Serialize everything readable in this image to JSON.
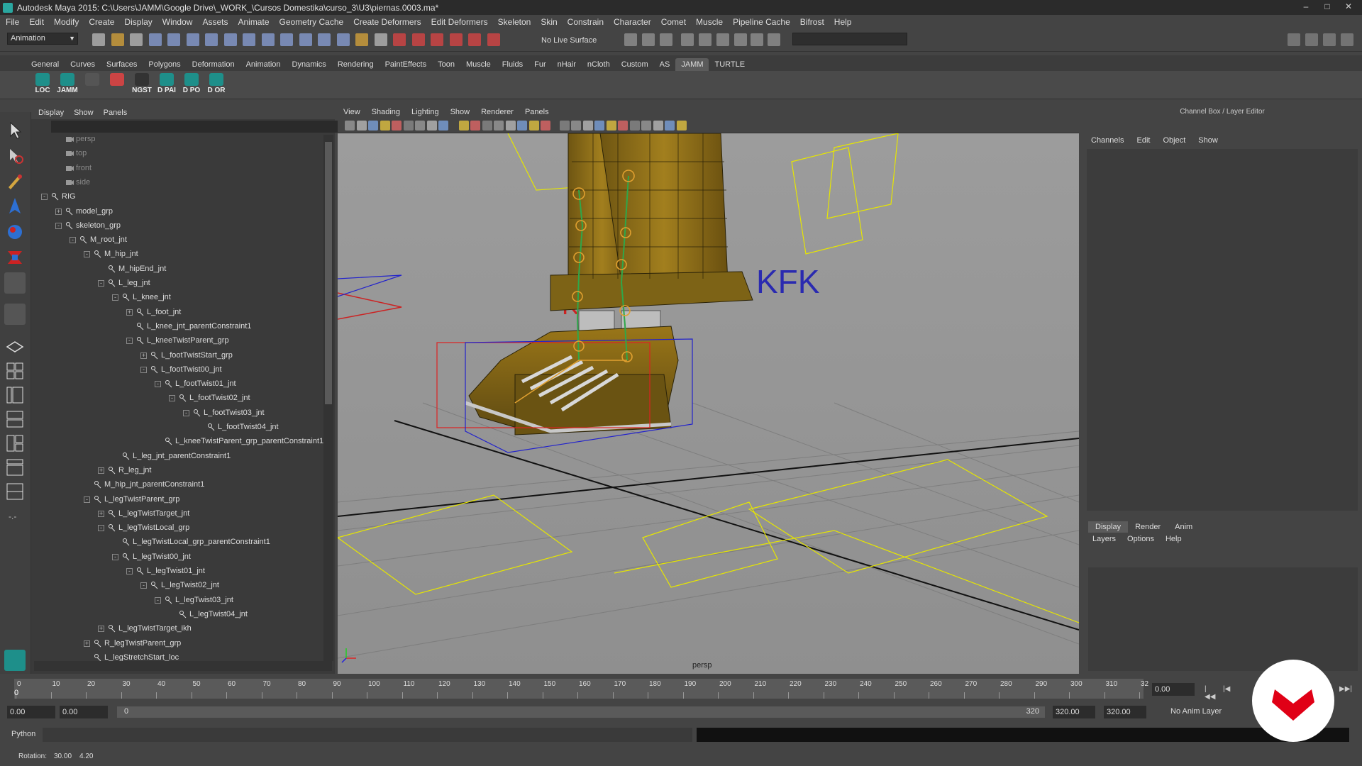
{
  "window": {
    "title": "Autodesk Maya 2015: C:\\Users\\JAMM\\Google Drive\\_WORK_\\Cursos Domestika\\curso_3\\U3\\piernas.0003.ma*"
  },
  "menubar": [
    "File",
    "Edit",
    "Modify",
    "Create",
    "Display",
    "Window",
    "Assets",
    "Animate",
    "Geometry Cache",
    "Create Deformers",
    "Edit Deformers",
    "Skeleton",
    "Skin",
    "Constrain",
    "Character",
    "Comet",
    "Muscle",
    "Pipeline Cache",
    "Bifrost",
    "Help"
  ],
  "statusline": {
    "mode": "Animation",
    "live_surface": "No Live Surface"
  },
  "shelf": {
    "tabs": [
      "General",
      "Curves",
      "Surfaces",
      "Polygons",
      "Deformation",
      "Animation",
      "Dynamics",
      "Rendering",
      "PaintEffects",
      "Toon",
      "Muscle",
      "Fluids",
      "Fur",
      "nHair",
      "nCloth",
      "Custom",
      "AS",
      "JAMM",
      "TURTLE"
    ],
    "active_tab": "JAMM",
    "buttons": [
      "LOC",
      "JAMM",
      "",
      "",
      "NGST",
      "D PAI",
      "D PO",
      "D OR"
    ]
  },
  "outliner": {
    "menu": [
      "Display",
      "Show",
      "Panels"
    ],
    "items": [
      {
        "label": "persp",
        "dim": true
      },
      {
        "label": "top",
        "dim": true
      },
      {
        "label": "front",
        "dim": true
      },
      {
        "label": "side",
        "dim": true
      },
      {
        "label": "RIG",
        "exp": "-"
      },
      {
        "label": "model_grp",
        "exp": "+"
      },
      {
        "label": "skeleton_grp",
        "exp": "-"
      },
      {
        "label": "M_root_jnt",
        "exp": "-"
      },
      {
        "label": "M_hip_jnt",
        "exp": "-"
      },
      {
        "label": "M_hipEnd_jnt"
      },
      {
        "label": "L_leg_jnt",
        "exp": "-"
      },
      {
        "label": "L_knee_jnt",
        "exp": "-"
      },
      {
        "label": "L_foot_jnt",
        "exp": "+"
      },
      {
        "label": "L_knee_jnt_parentConstraint1"
      },
      {
        "label": "L_kneeTwistParent_grp",
        "exp": "-"
      },
      {
        "label": "L_footTwistStart_grp",
        "exp": "+"
      },
      {
        "label": "L_footTwist00_jnt",
        "exp": "-"
      },
      {
        "label": "L_footTwist01_jnt",
        "exp": "-"
      },
      {
        "label": "L_footTwist02_jnt",
        "exp": "-"
      },
      {
        "label": "L_footTwist03_jnt",
        "exp": "-"
      },
      {
        "label": "L_footTwist04_jnt"
      },
      {
        "label": "L_kneeTwistParent_grp_parentConstraint1"
      },
      {
        "label": "L_leg_jnt_parentConstraint1"
      },
      {
        "label": "R_leg_jnt",
        "exp": "+"
      },
      {
        "label": "M_hip_jnt_parentConstraint1"
      },
      {
        "label": "L_legTwistParent_grp",
        "exp": "-"
      },
      {
        "label": "L_legTwistTarget_jnt",
        "exp": "+"
      },
      {
        "label": "L_legTwistLocal_grp",
        "exp": "-"
      },
      {
        "label": "L_legTwistLocal_grp_parentConstraint1"
      },
      {
        "label": "L_legTwist00_jnt",
        "exp": "-"
      },
      {
        "label": "L_legTwist01_jnt",
        "exp": "-"
      },
      {
        "label": "L_legTwist02_jnt",
        "exp": "-"
      },
      {
        "label": "L_legTwist03_jnt",
        "exp": "-"
      },
      {
        "label": "L_legTwist04_jnt"
      },
      {
        "label": "L_legTwistTarget_ikh",
        "exp": "+"
      },
      {
        "label": "R_legTwistParent_grp",
        "exp": "+"
      },
      {
        "label": "L_legStretchStart_loc"
      }
    ]
  },
  "viewport": {
    "menu": [
      "View",
      "Shading",
      "Lighting",
      "Show",
      "Renderer",
      "Panels"
    ],
    "camera_label": "persp",
    "scene_text": "KFK"
  },
  "channelbox": {
    "title": "Channel Box / Layer Editor",
    "menu": [
      "Channels",
      "Edit",
      "Object",
      "Show"
    ],
    "layer_tabs": [
      "Display",
      "Render",
      "Anim"
    ],
    "layer_menu": [
      "Layers",
      "Options",
      "Help"
    ]
  },
  "timeline": {
    "ticks": [
      "0",
      "10",
      "20",
      "30",
      "40",
      "50",
      "60",
      "70",
      "80",
      "90",
      "100",
      "110",
      "120",
      "130",
      "140",
      "150",
      "160",
      "170",
      "180",
      "190",
      "200",
      "210",
      "220",
      "230",
      "240",
      "250",
      "260",
      "270",
      "280",
      "290",
      "300",
      "310",
      "32"
    ],
    "current_frame": "0.00",
    "playhead_label": "0"
  },
  "range": {
    "start": "0.00",
    "anim_start": "0.00",
    "slider_start": "0",
    "slider_end": "320",
    "anim_end": "320.00",
    "end": "320.00",
    "anim_layer": "No Anim Layer"
  },
  "cmdline": {
    "label": "Python"
  },
  "helpline": {
    "label": "Rotation:",
    "v1": "30.00",
    "v2": "4.20"
  }
}
